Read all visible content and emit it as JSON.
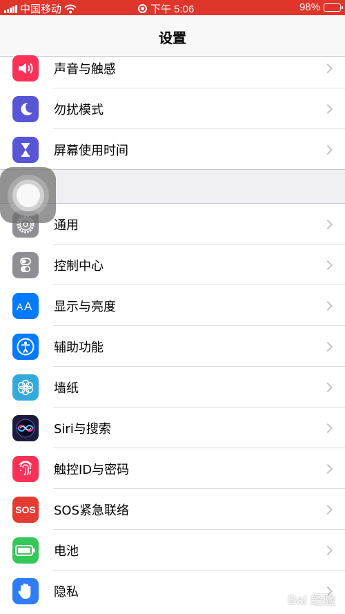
{
  "status_bar": {
    "carrier": "中国移动",
    "time": "下午 5:06",
    "battery_percent": "98%",
    "battery_level": 0.98,
    "background_color": "#e0352a"
  },
  "nav": {
    "title": "设置"
  },
  "group1": [
    {
      "label": "声音与触感",
      "icon": "speaker-icon",
      "color": "#fc3158"
    },
    {
      "label": "勿扰模式",
      "icon": "moon-icon",
      "color": "#5856d6"
    },
    {
      "label": "屏幕使用时间",
      "icon": "hourglass-icon",
      "color": "#5856d6"
    }
  ],
  "group2": [
    {
      "label": "通用",
      "icon": "gear-icon",
      "color": "#8e8e93"
    },
    {
      "label": "控制中心",
      "icon": "toggles-icon",
      "color": "#8e8e93"
    },
    {
      "label": "显示与亮度",
      "icon": "text-size-icon",
      "color": "#007aff"
    },
    {
      "label": "辅助功能",
      "icon": "accessibility-icon",
      "color": "#007aff"
    },
    {
      "label": "墙纸",
      "icon": "flower-icon",
      "color": "#34aadc"
    },
    {
      "label": "Siri与搜索",
      "icon": "siri-icon",
      "color": "#1c1c3a"
    },
    {
      "label": "触控ID与密码",
      "icon": "fingerprint-icon",
      "color": "#fc3158"
    },
    {
      "label": "SOS紧急联络",
      "icon": "sos-icon",
      "color": "#e53b30",
      "icon_text": "SOS"
    },
    {
      "label": "电池",
      "icon": "battery-icon",
      "color": "#34c759"
    },
    {
      "label": "隐私",
      "icon": "hand-icon",
      "color": "#2f7cf6"
    }
  ],
  "watermark": "Bai 经验"
}
